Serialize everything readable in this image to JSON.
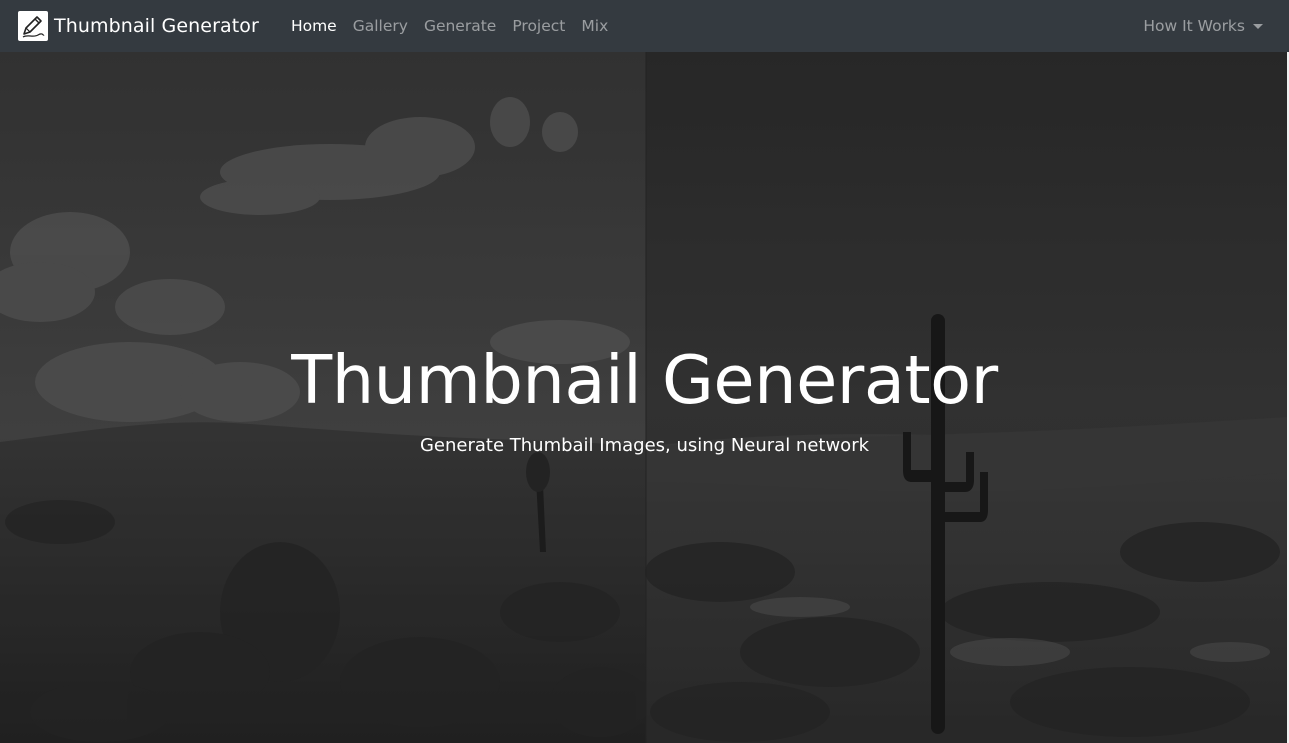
{
  "navbar": {
    "brand": "Thumbnail Generator",
    "logo_icon": "pen-drawing-icon",
    "links": [
      {
        "label": "Home",
        "active": true
      },
      {
        "label": "Gallery",
        "active": false
      },
      {
        "label": "Generate",
        "active": false
      },
      {
        "label": "Project",
        "active": false
      },
      {
        "label": "Mix",
        "active": false
      }
    ],
    "dropdown": {
      "label": "How It Works",
      "icon": "caret-down-icon"
    }
  },
  "hero": {
    "title": "Thumbnail Generator",
    "subtitle": "Generate Thumbail Images, using Neural network"
  },
  "colors": {
    "navbar_bg": "#343a40",
    "nav_active": "#ffffff",
    "nav_inactive": "rgba(255,255,255,0.5)",
    "hero_overlay": "#000000"
  }
}
